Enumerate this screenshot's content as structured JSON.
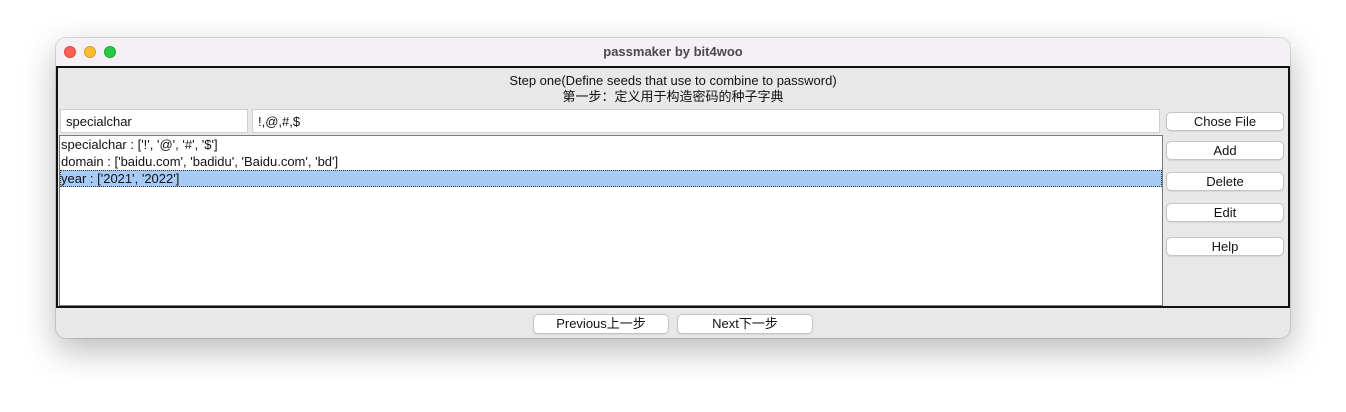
{
  "window": {
    "title": "passmaker by bit4woo"
  },
  "header": {
    "step_en": "Step one(Define seeds that use to combine to password)",
    "step_zh": "第一步：定义用于构造密码的种子字典"
  },
  "inputs": {
    "seed_name": "specialchar",
    "seed_values": "!,@,#,$"
  },
  "seed_list": {
    "items": [
      "specialchar : ['!', '@', '#', '$']",
      "domain : ['baidu.com', 'badidu', 'Baidu.com', 'bd']",
      "year : ['2021', '2022']"
    ],
    "selected_index": 2
  },
  "buttons": {
    "chose_file": "Chose File",
    "add": "Add",
    "delete": "Delete",
    "edit": "Edit",
    "help": "Help",
    "previous": "Previous上一步",
    "next": "Next下一步"
  },
  "colors": {
    "selection": "#a8cbf6",
    "titlebar": "#f5eff6",
    "close": "#fe5f57",
    "minimize": "#febc2e",
    "maximize": "#28c840"
  }
}
